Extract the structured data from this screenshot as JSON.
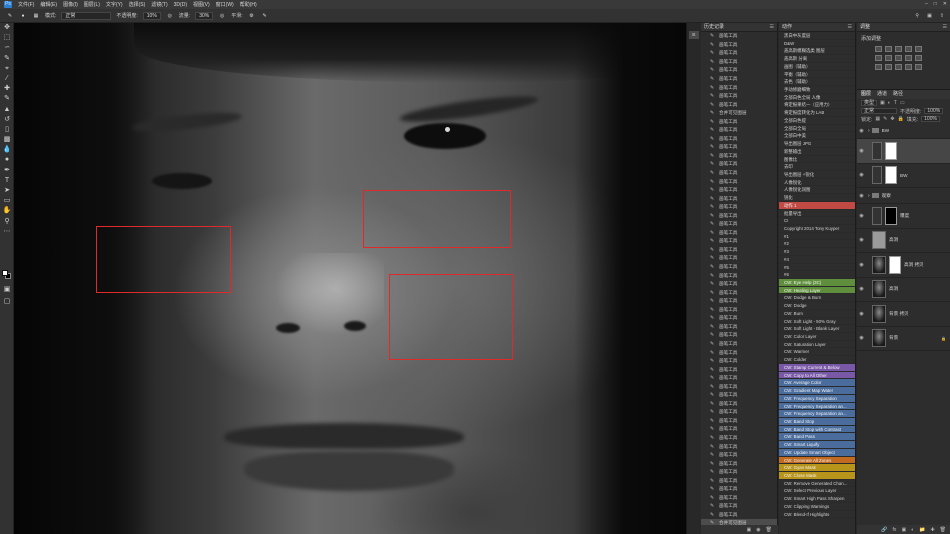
{
  "app": {
    "logo": "Ps"
  },
  "menu": [
    "文件(F)",
    "编辑(E)",
    "图像(I)",
    "图层(L)",
    "文字(Y)",
    "选择(S)",
    "滤镜(T)",
    "3D(D)",
    "视图(V)",
    "窗口(W)",
    "帮助(H)"
  ],
  "options": {
    "mode_label": "模式:",
    "mode_value": "正常",
    "opacity_label": "不透明度:",
    "opacity_value": "10%",
    "flow_label": "流量:",
    "flow_value": "30%",
    "smooth_label": "平滑:"
  },
  "history": {
    "title": "历史记录",
    "items": [
      "画笔工具",
      "画笔工具",
      "画笔工具",
      "画笔工具",
      "画笔工具",
      "画笔工具",
      "画笔工具",
      "画笔工具",
      "画笔工具",
      "合并可见图层",
      "画笔工具",
      "画笔工具",
      "画笔工具",
      "画笔工具",
      "画笔工具",
      "画笔工具",
      "画笔工具",
      "画笔工具",
      "画笔工具",
      "画笔工具",
      "画笔工具",
      "画笔工具",
      "画笔工具",
      "画笔工具",
      "画笔工具",
      "画笔工具",
      "画笔工具",
      "画笔工具",
      "画笔工具",
      "画笔工具",
      "画笔工具",
      "画笔工具",
      "画笔工具",
      "画笔工具",
      "画笔工具",
      "画笔工具",
      "画笔工具",
      "画笔工具",
      "画笔工具",
      "画笔工具",
      "画笔工具",
      "画笔工具",
      "画笔工具",
      "画笔工具",
      "画笔工具",
      "画笔工具",
      "画笔工具",
      "画笔工具",
      "画笔工具",
      "画笔工具",
      "画笔工具",
      "画笔工具",
      "画笔工具",
      "画笔工具",
      "画笔工具",
      "画笔工具",
      "画笔工具",
      "合并可见图层"
    ]
  },
  "actions": {
    "title": "动作",
    "items": [
      {
        "label": "黑白中灰度层",
        "color": ""
      },
      {
        "label": "D&W",
        "color": ""
      },
      {
        "label": "盖高斯模糊选类 图层",
        "color": ""
      },
      {
        "label": "盖高斯 分离",
        "color": ""
      },
      {
        "label": "画图（辅助）",
        "color": ""
      },
      {
        "label": "平衡（辅助）",
        "color": ""
      },
      {
        "label": "去色（辅助）",
        "color": ""
      },
      {
        "label": "手动修磨细致",
        "color": ""
      },
      {
        "label": "全部白色全局 人像",
        "color": ""
      },
      {
        "label": "将定报果结一（应用力）",
        "color": ""
      },
      {
        "label": "将定报度转化为 LAB",
        "color": ""
      },
      {
        "label": "全部白色提",
        "color": ""
      },
      {
        "label": "全部白全局",
        "color": ""
      },
      {
        "label": "全部白中美",
        "color": ""
      },
      {
        "label": "导出图层 JPG",
        "color": ""
      },
      {
        "label": "新整输出",
        "color": ""
      },
      {
        "label": "图像比",
        "color": ""
      },
      {
        "label": "去印",
        "color": ""
      },
      {
        "label": "导出图层 +锐化",
        "color": ""
      },
      {
        "label": "人像锐化",
        "color": ""
      },
      {
        "label": "人像锐化润图",
        "color": ""
      },
      {
        "label": "锐化",
        "color": ""
      },
      {
        "label": "动作 1",
        "color": "#c24a45"
      },
      {
        "label": "批量导出",
        "color": ""
      },
      {
        "label": "CI",
        "color": ""
      },
      {
        "label": "Copyright 2014 Tony Kuyper",
        "color": ""
      },
      {
        "label": "#1",
        "color": ""
      },
      {
        "label": "#2",
        "color": ""
      },
      {
        "label": "#3",
        "color": ""
      },
      {
        "label": "#4",
        "color": ""
      },
      {
        "label": "#5",
        "color": ""
      },
      {
        "label": "#6",
        "color": ""
      },
      {
        "label": "CW: Eye Help (3C)",
        "color": "#5f8f3c"
      },
      {
        "label": "CW: Healing Layer",
        "color": "#5f8f3c"
      },
      {
        "label": "CW: Dodge & Burn",
        "color": ""
      },
      {
        "label": "CW: Dodge",
        "color": ""
      },
      {
        "label": "CW: Burn",
        "color": ""
      },
      {
        "label": "CW: Soft Light - 50% Gray",
        "color": ""
      },
      {
        "label": "CW: Soft Light - Blank Layer",
        "color": ""
      },
      {
        "label": "CW: Color Layer",
        "color": ""
      },
      {
        "label": "CW: Saturation Layer",
        "color": ""
      },
      {
        "label": "CW: Warmer",
        "color": ""
      },
      {
        "label": "CW: Colder",
        "color": ""
      },
      {
        "label": "CW: Stamp Current & Below",
        "color": "#7a58a8"
      },
      {
        "label": "CW: Copy to All Other",
        "color": "#7a58a8"
      },
      {
        "label": "CW: Average Color",
        "color": "#4a6d9e"
      },
      {
        "label": "CW: Gradient Map Water",
        "color": "#4a6d9e"
      },
      {
        "label": "CW: Frequency Separation",
        "color": "#4a6d9e"
      },
      {
        "label": "CW: Frequency Separation an...",
        "color": "#4a6d9e"
      },
      {
        "label": "CW: Frequency Separation an...",
        "color": "#4a6d9e"
      },
      {
        "label": "CW: Band Stop",
        "color": "#4a6d9e"
      },
      {
        "label": "CW: Band Stop with Contrast",
        "color": "#4a6d9e"
      },
      {
        "label": "CW: Band Pass",
        "color": "#4a6d9e"
      },
      {
        "label": "CW: Smart Liquify",
        "color": "#4a6d9e"
      },
      {
        "label": "CW: Update Smart Object",
        "color": "#4a6d9e"
      },
      {
        "label": "CW: Generate All Zones",
        "color": "#c26a1f"
      },
      {
        "label": "CW: Gyan Mask",
        "color": "#b8941a"
      },
      {
        "label": "CW: Close Mask",
        "color": "#b8941a"
      },
      {
        "label": "CW: Remove Generated Chan...",
        "color": ""
      },
      {
        "label": "CW: Select Previous Layer",
        "color": ""
      },
      {
        "label": "CW: Smart High Pass Sharpen",
        "color": ""
      },
      {
        "label": "CW: Clipping Warnings",
        "color": ""
      },
      {
        "label": "CW: Blend-If Highlights",
        "color": ""
      }
    ]
  },
  "adjustments": {
    "title": "调整",
    "subtitle": "添加调整"
  },
  "layers": {
    "tabs": [
      "图层",
      "通道",
      "路径"
    ],
    "kind": "类型",
    "blend": "正常",
    "opacity_label": "不透明度:",
    "opacity_value": "100%",
    "lock_label": "锁定:",
    "fill_label": "填充:",
    "fill_value": "100%",
    "items": [
      {
        "name": "BW",
        "kind": "group"
      },
      {
        "name": "",
        "kind": "adj-white",
        "active": true
      },
      {
        "name": "BW",
        "kind": "adj-white"
      },
      {
        "name": "观察",
        "kind": "group"
      },
      {
        "name": "曝度",
        "kind": "adj-black"
      },
      {
        "name": "高洞",
        "kind": "grey"
      },
      {
        "name": "高洞 拷贝",
        "kind": "face-mask"
      },
      {
        "name": "高洞",
        "kind": "face"
      },
      {
        "name": "背景 拷贝",
        "kind": "face"
      },
      {
        "name": "背景",
        "kind": "face-lock"
      }
    ]
  }
}
